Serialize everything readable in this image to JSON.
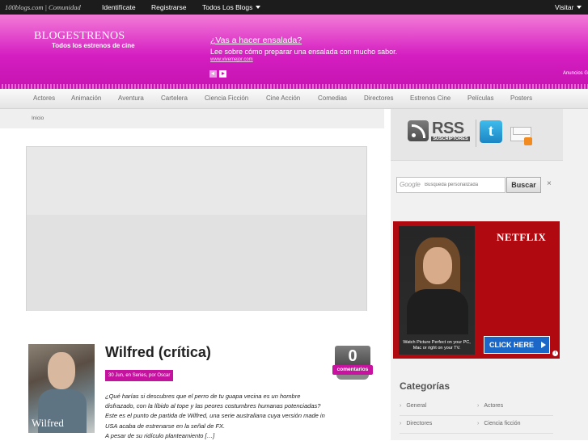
{
  "topbar": {
    "brand": "100blogs.com | Comunidad",
    "identificate": "Identifícate",
    "registrarse": "Registrarse",
    "todos_blogs": "Todos Los Blogs",
    "visitar": "Visitar"
  },
  "header": {
    "title": "BLOGESTRENOS",
    "subtitle": "Todos los estrenos de cine"
  },
  "ad": {
    "headline": "¿Vas a hacer ensalada?",
    "text": "Lee sobre cómo preparar una ensalada con mucho sabor.",
    "url": "www.vivemejor.com",
    "label": "Anuncios G"
  },
  "nav": {
    "items": [
      "Actores",
      "Animación",
      "Aventura",
      "Cartelera",
      "Ciencia Ficción",
      "Cine Acción",
      "Comedias",
      "Directores",
      "Estrenos Cine",
      "Películas",
      "Posters"
    ]
  },
  "breadcrumb": "Inicio",
  "post": {
    "image_title": "Wilfred",
    "title": "Wilfred (crítica)",
    "meta": "30 Jun, en Series, por Oscar",
    "excerpt_1": "¿Qué harías si descubres que el perro de tu guapa vecina es un hombre disfrazado, con la líbido al tope y las peores costumbres humanas potenciadas? Este es el punto de partida de Wilfred, una serie australiana cuya versión made in USA acaba de estrenarse en la señal de FX.",
    "excerpt_2": "A pesar de su ridículo planteamiento […]",
    "comments_count": "0",
    "comments_label": "comentarios"
  },
  "sidebar": {
    "rss_text": "RSS",
    "rss_sub": "SUSCRIPTORES",
    "tumblr_letter": "t",
    "search_brand": "Google",
    "search_placeholder": "Búsqueda personalizada",
    "search_button": "Buscar",
    "search_clear": "×",
    "netflix_logo": "NETFLIX",
    "netflix_caption": "Watch Picture Perfect on your PC, Mac or right on your TV.",
    "netflix_cta": "CLICK HERE",
    "categories_title": "Categorías",
    "categories": [
      "General",
      "Actores",
      "Directores",
      "Ciencia ficción"
    ]
  },
  "colors": {
    "brand_pink": "#d51ec1",
    "topbar": "#1c1c1c",
    "netflix_red": "#b0090f"
  }
}
